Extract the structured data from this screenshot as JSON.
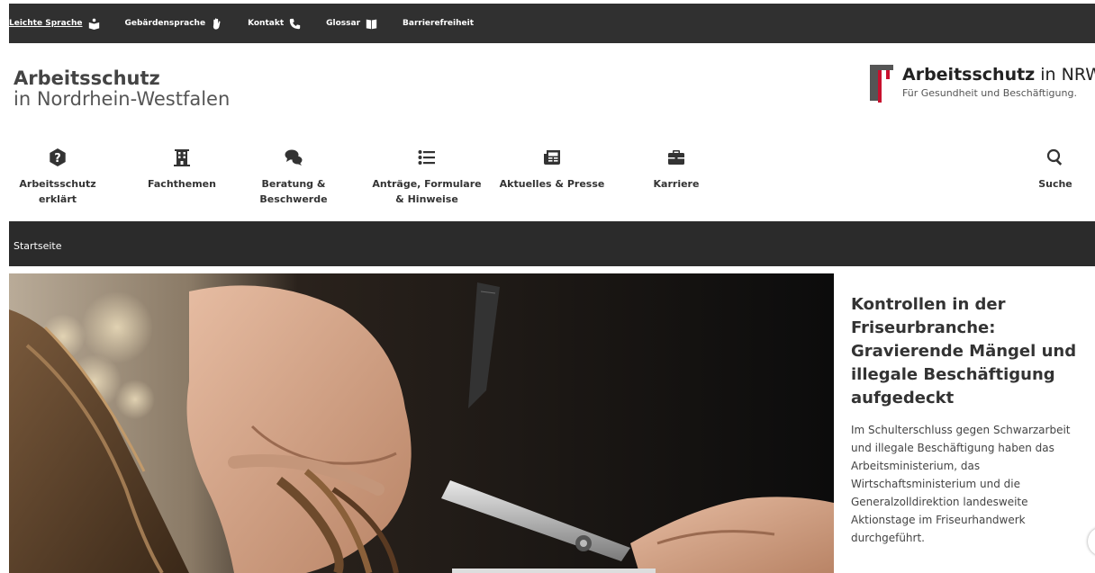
{
  "topbar": {
    "items": [
      {
        "label": "Leichte Sprache",
        "icon": "book-reader-icon"
      },
      {
        "label": "Gebärdensprache",
        "icon": "hand-icon"
      },
      {
        "label": "Kontakt",
        "icon": "phone-icon"
      },
      {
        "label": "Glossar",
        "icon": "open-book-icon"
      },
      {
        "label": "Barrierefreiheit"
      }
    ]
  },
  "header": {
    "title_line1": "Arbeitsschutz",
    "title_line2": "in Nordrhein-Westfalen",
    "brand_bold": "Arbeitsschutz",
    "brand_rest": " in NRW",
    "brand_tagline": "Für Gesundheit und Beschäftigung."
  },
  "nav": {
    "items": [
      {
        "line1": "Arbeitsschutz",
        "line2": "erklärt",
        "icon": "question-icon"
      },
      {
        "line1": "Fachthemen",
        "line2": "",
        "icon": "building-icon"
      },
      {
        "line1": "Beratung &",
        "line2": "Beschwerde",
        "icon": "comments-icon"
      },
      {
        "line1": "Anträge, Formulare",
        "line2": "& Hinweise",
        "icon": "list-icon"
      },
      {
        "line1": "Aktuelles & Presse",
        "line2": "",
        "icon": "newspaper-icon"
      },
      {
        "line1": "Karriere",
        "line2": "",
        "icon": "briefcase-icon"
      },
      {
        "line1": "Suche",
        "line2": "",
        "icon": "search-icon"
      }
    ]
  },
  "breadcrumb": {
    "current": "Startseite"
  },
  "teaser": {
    "heading": "Kontrollen in der Friseurbranche: Gravierende Mängel und illegale Beschäftigung aufgedeckt",
    "text": "Im Schulterschluss gegen Schwarzarbeit und illegale Beschäftigung haben das Arbeitsministerium, das Wirtschaftsministerium und die Generalzolldirektion landesweite Aktionstage im Friseurhandwerk durchgeführt."
  },
  "colors": {
    "topbar": "#303030",
    "breadcrumb": "#2b2b2b",
    "brand_red": "#c8102e"
  }
}
